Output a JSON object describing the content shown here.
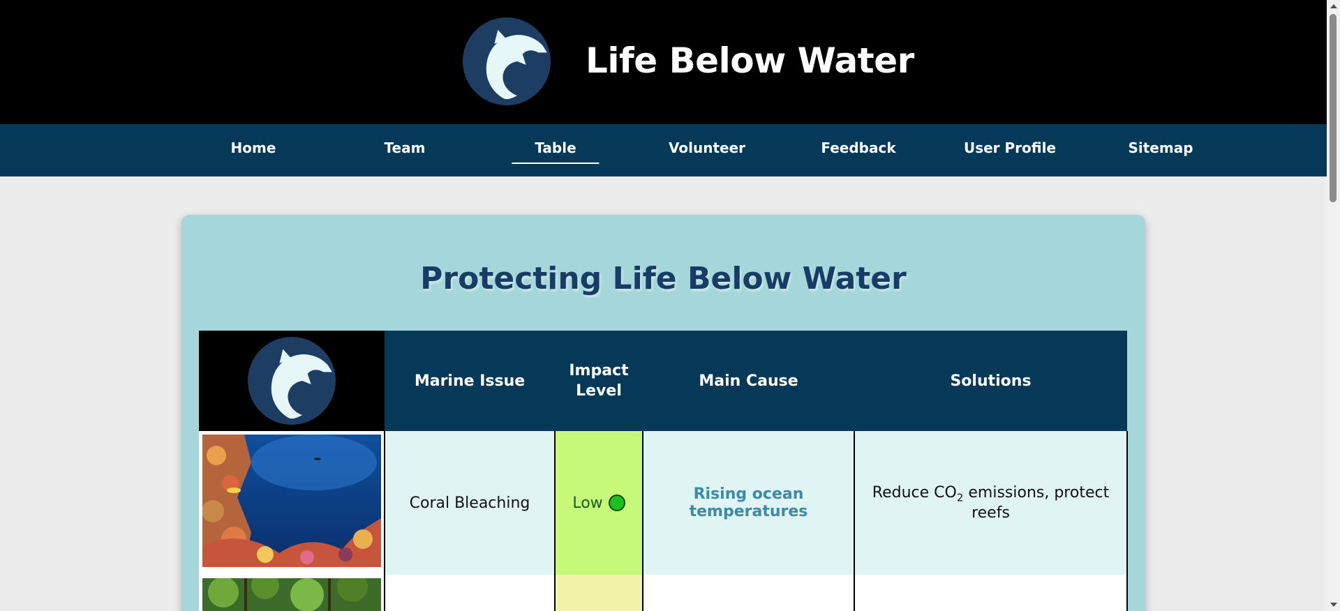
{
  "header": {
    "title": "Life Below Water",
    "logo_icon": "dolphin-logo-icon"
  },
  "nav": {
    "items": [
      {
        "label": "Home"
      },
      {
        "label": "Team"
      },
      {
        "label": "Table",
        "active": true
      },
      {
        "label": "Volunteer"
      },
      {
        "label": "Feedback"
      },
      {
        "label": "User Profile"
      },
      {
        "label": "Sitemap"
      }
    ]
  },
  "main": {
    "title": "Protecting Life Below Water",
    "table": {
      "headers": [
        "Marine Issue",
        "Impact Level",
        "Main Cause",
        "Solutions"
      ],
      "rows": [
        {
          "image": "coral-reef-photo",
          "issue": "Coral Bleaching",
          "impact": "Low",
          "impact_color": "#1bc21b",
          "cause": "Rising ocean temperatures",
          "solution_pre": "Reduce CO",
          "solution_sub": "2",
          "solution_post": " emissions, protect reefs"
        },
        {
          "image": "forest-photo",
          "issue": "",
          "impact": "",
          "cause": "",
          "solution_pre": "",
          "solution_sub": "",
          "solution_post": ""
        }
      ]
    }
  },
  "colors": {
    "header_bg": "#000000",
    "nav_bg": "#063857",
    "card_bg": "#a5d6da",
    "title": "#173d66",
    "cause_link": "#3d8aa3",
    "impact_low_bg": "#c6f97a",
    "impact_med_bg": "#f3f2a9"
  }
}
